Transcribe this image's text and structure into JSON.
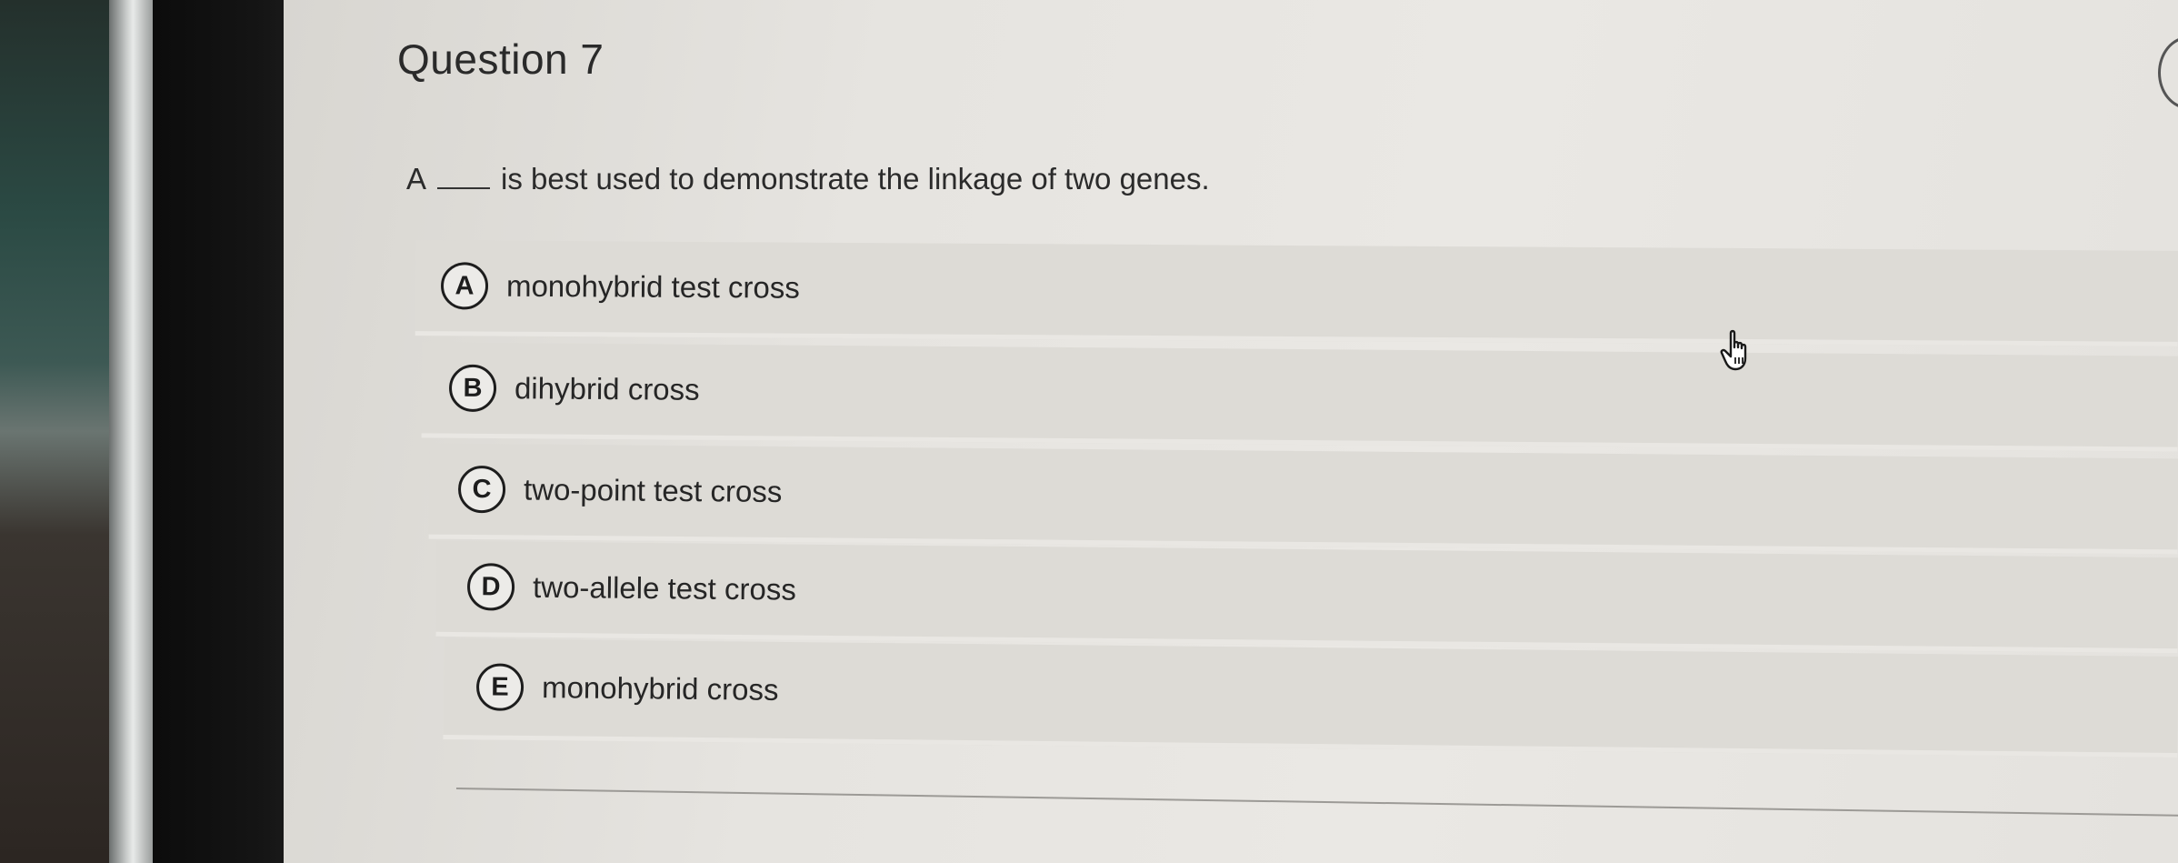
{
  "question": {
    "title": "Question 7",
    "prompt_before": "A",
    "prompt_after": "is best used to demonstrate the linkage of two genes."
  },
  "options": [
    {
      "letter": "A",
      "text": "monohybrid test cross"
    },
    {
      "letter": "B",
      "text": "dihybrid cross"
    },
    {
      "letter": "C",
      "text": "two-point test cross"
    },
    {
      "letter": "D",
      "text": "two-allele test cross"
    },
    {
      "letter": "E",
      "text": "monohybrid cross"
    }
  ],
  "cursor": {
    "icon": "hand-pointer-icon"
  }
}
